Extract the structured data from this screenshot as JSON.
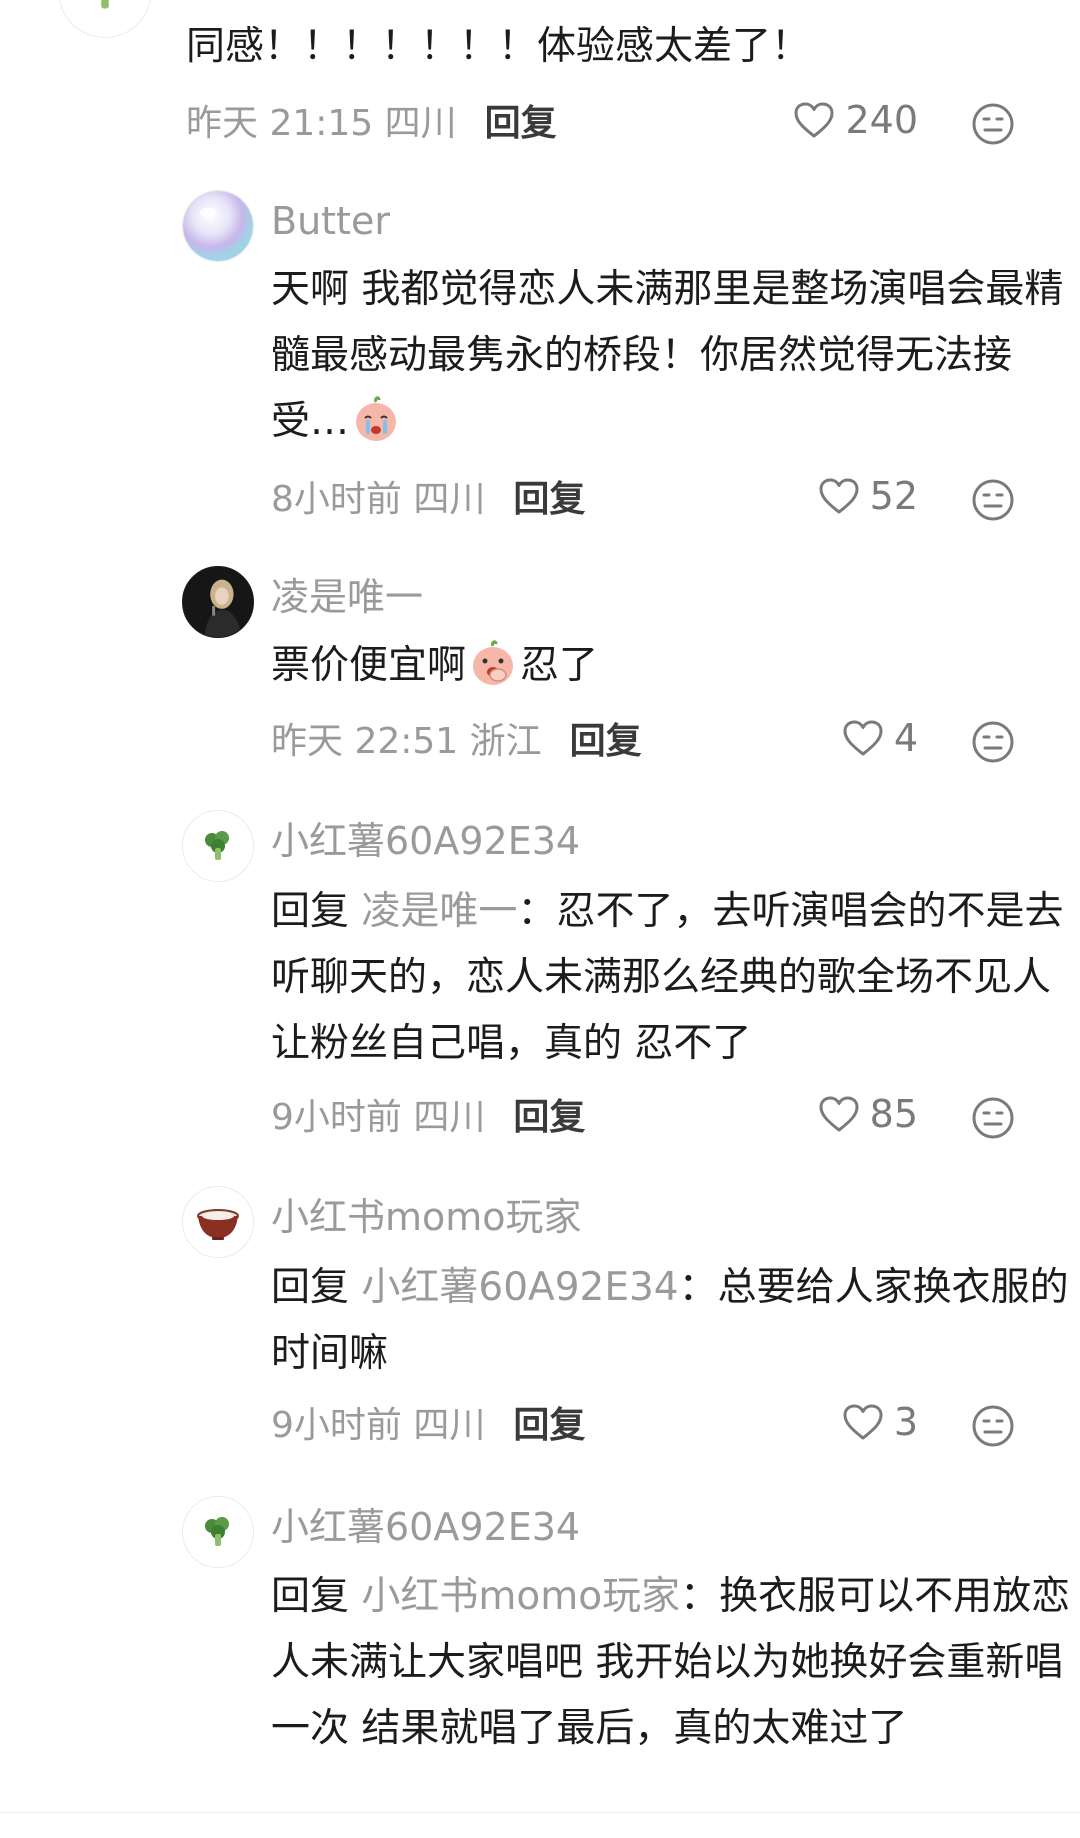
{
  "comments": [
    {
      "id": "top",
      "avatar_icon": "broccoli-icon",
      "text": "同感！！！！！！！体验感太差了！",
      "time": "昨天 21:15 四川",
      "reply_label": "回复",
      "likes": "240"
    },
    {
      "id": "r1",
      "username": "Butter",
      "avatar_icon": "bubble-avatar",
      "text": "天啊 我都觉得恋人未满那里是整场演唱会最精髓最感动最隽永的桥段！你居然觉得无法接受…",
      "text_emoji": "crying-face-emoji",
      "time": "8小时前 四川",
      "reply_label": "回复",
      "likes": "52"
    },
    {
      "id": "r2",
      "username": "凌是唯一",
      "avatar_icon": "singer-photo-avatar",
      "text_before": "票价便宜啊",
      "text_emoji": "hand-over-mouth-emoji",
      "text_after": "忍了",
      "time": "昨天 22:51 浙江",
      "reply_label": "回复",
      "likes": "4"
    },
    {
      "id": "r3",
      "username": "小红薯60A92E34",
      "avatar_icon": "broccoli-icon",
      "reply_prefix": "回复",
      "reply_target": "凌是唯一",
      "text": "：忍不了，去听演唱会的不是去听聊天的，恋人未满那么经典的歌全场不见人 让粉丝自己唱，真的 忍不了",
      "time": "9小时前 四川",
      "reply_label": "回复",
      "likes": "85"
    },
    {
      "id": "r4",
      "username": "小红书momo玩家",
      "avatar_icon": "bowl-icon",
      "reply_prefix": "回复",
      "reply_target": "小红薯60A92E34",
      "text": "：总要给人家换衣服的时间嘛",
      "time": "9小时前 四川",
      "reply_label": "回复",
      "likes": "3"
    },
    {
      "id": "r5",
      "username": "小红薯60A92E34",
      "avatar_icon": "broccoli-icon",
      "reply_prefix": "回复",
      "reply_target": "小红书momo玩家",
      "text": "：换衣服可以不用放恋人未满让大家唱吧 我开始以为她换好会重新唱一次 结果就唱了最后，真的太难过了"
    }
  ],
  "colors": {
    "text": "#1c1c1c",
    "secondary": "#9a9a9a",
    "reply_button": "#3a3a3a",
    "broccoli": "#4a8a3a"
  },
  "icons": {
    "like": "heart-outline-icon",
    "reaction": "neutral-face-icon"
  }
}
